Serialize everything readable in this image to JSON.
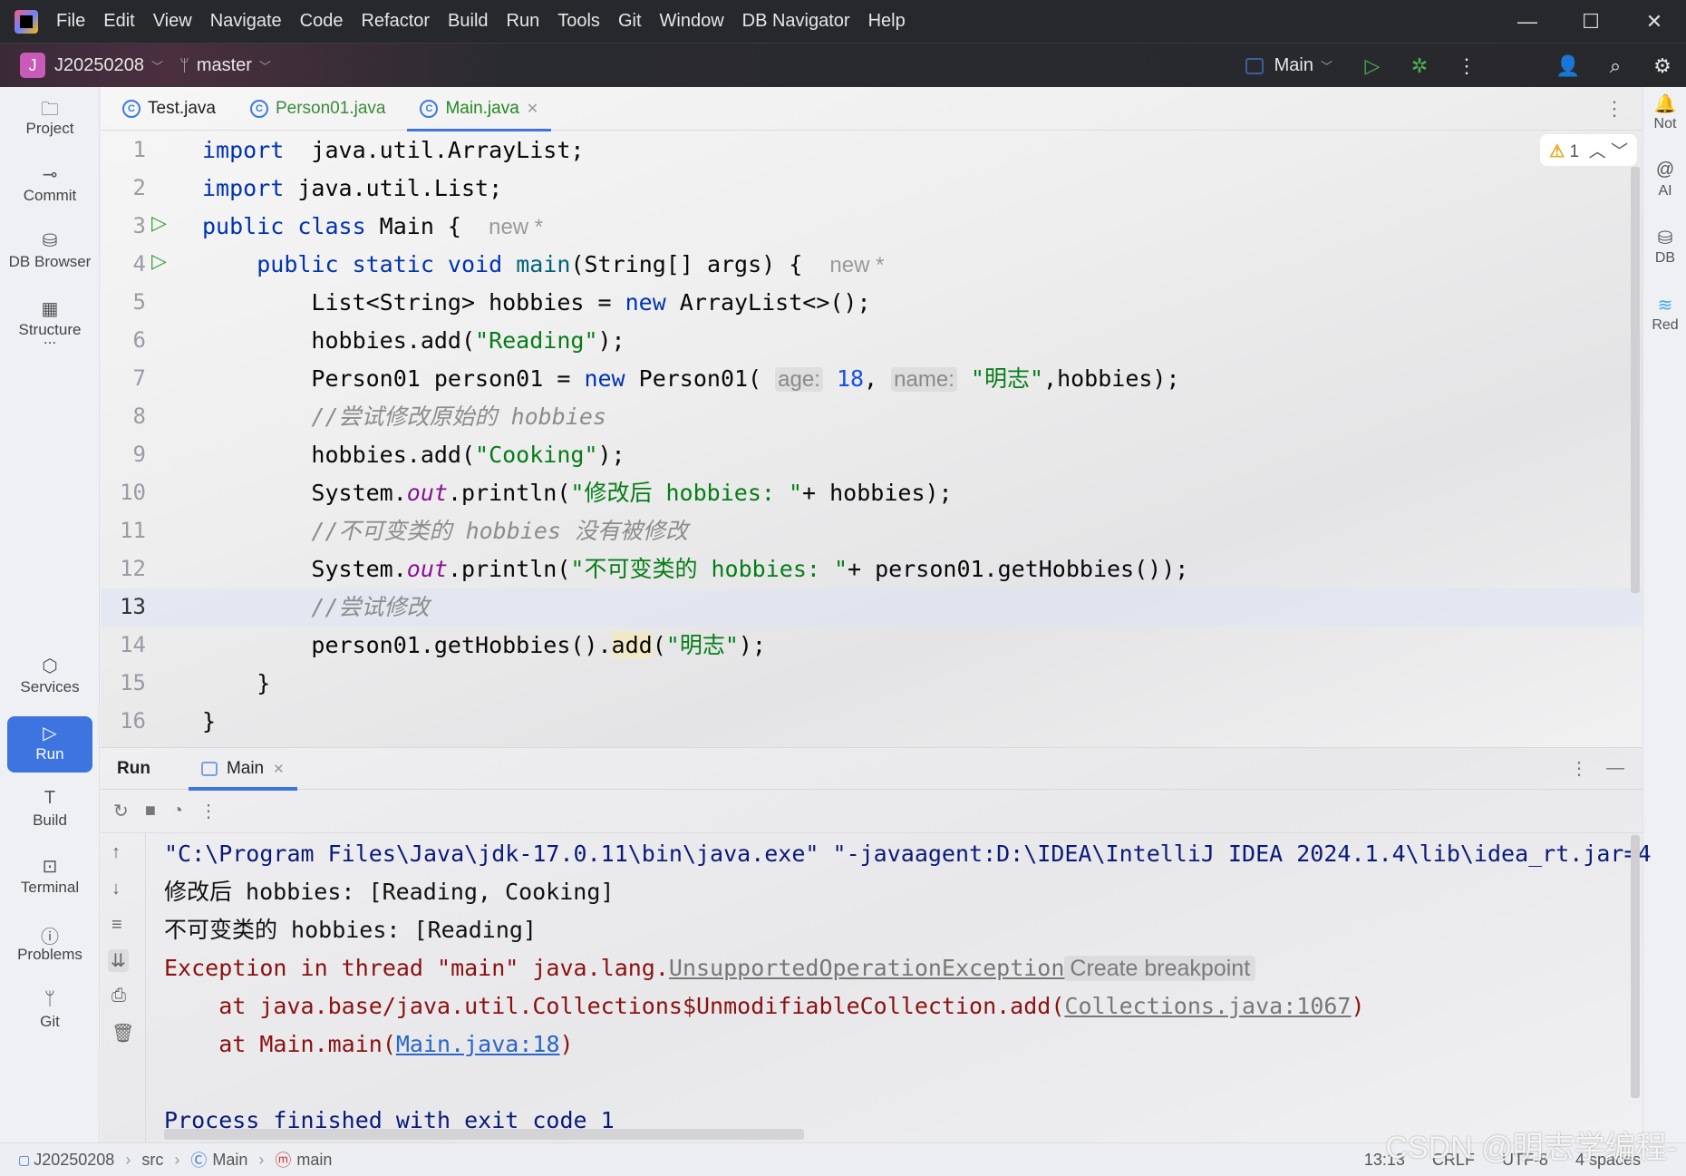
{
  "menu": [
    "File",
    "Edit",
    "View",
    "Navigate",
    "Code",
    "Refactor",
    "Build",
    "Run",
    "Tools",
    "Git",
    "Window",
    "DB Navigator",
    "Help"
  ],
  "toolbar": {
    "project_initial": "J",
    "project": "J20250208",
    "branch": "master",
    "run_config": "Main"
  },
  "left_sidebar": [
    {
      "label": "Project",
      "icon": "folder-icon"
    },
    {
      "label": "Commit",
      "icon": "commit-icon"
    },
    {
      "label": "DB Browser",
      "icon": "db-browser-icon"
    },
    {
      "label": "Structure",
      "icon": "structure-icon"
    },
    {
      "label": "...",
      "icon": "more-icon"
    },
    {
      "label": "Services",
      "icon": "services-icon"
    },
    {
      "label": "Run",
      "icon": "run-icon",
      "active": true
    },
    {
      "label": "Build",
      "icon": "hammer-icon"
    },
    {
      "label": "Terminal",
      "icon": "terminal-icon"
    },
    {
      "label": "Problems",
      "icon": "problems-icon"
    },
    {
      "label": "Git",
      "icon": "git-icon"
    }
  ],
  "right_sidebar": [
    {
      "label": "Not"
    },
    {
      "label": "AI"
    },
    {
      "label": "DB"
    },
    {
      "label": "Red"
    }
  ],
  "tabs": [
    {
      "label": "Test.java"
    },
    {
      "label": "Person01.java"
    },
    {
      "label": "Main.java",
      "active": true
    }
  ],
  "inspections": {
    "warnings": "1"
  },
  "editor": {
    "current_line": 13,
    "line_numbers": [
      "1",
      "2",
      "3",
      "4",
      "5",
      "6",
      "7",
      "8",
      "9",
      "10",
      "11",
      "12",
      "13",
      "14",
      "15",
      "16"
    ],
    "lines": [
      [
        [
          "kw",
          "import"
        ],
        [
          "",
          "  java.util.ArrayList;"
        ]
      ],
      [
        [
          "kw",
          "import"
        ],
        [
          "",
          " java.util.List;"
        ]
      ],
      [
        [
          "kw",
          "public class"
        ],
        [
          "",
          " Main {  "
        ],
        [
          "ghost",
          "new *"
        ]
      ],
      [
        [
          "",
          "    "
        ],
        [
          "kw",
          "public static void"
        ],
        [
          "",
          " "
        ],
        [
          "fn",
          "main"
        ],
        [
          "",
          "(String[] args) {  "
        ],
        [
          "ghost",
          "new *"
        ]
      ],
      [
        [
          "",
          "        List<String> hobbies = "
        ],
        [
          "kw",
          "new"
        ],
        [
          "",
          " ArrayList<>();"
        ]
      ],
      [
        [
          "",
          "        hobbies.add("
        ],
        [
          "str",
          "\"Reading\""
        ],
        [
          "",
          ");"
        ]
      ],
      [
        [
          "",
          "        Person01 person01 = "
        ],
        [
          "kw",
          "new"
        ],
        [
          "",
          " Person01( "
        ],
        [
          "hint",
          "age:"
        ],
        [
          "num",
          " 18"
        ],
        [
          "",
          ", "
        ],
        [
          "hint",
          "name:"
        ],
        [
          "str",
          " \"明志\""
        ],
        [
          "",
          ",hobbies);"
        ]
      ],
      [
        [
          "cm",
          "        //尝试修改原始的 hobbies"
        ]
      ],
      [
        [
          "",
          "        hobbies.add("
        ],
        [
          "str",
          "\"Cooking\""
        ],
        [
          "",
          ");"
        ]
      ],
      [
        [
          "",
          "        System."
        ],
        [
          "fld",
          "out"
        ],
        [
          "",
          ".println("
        ],
        [
          "str",
          "\"修改后 hobbies: \""
        ],
        [
          "",
          "+ hobbies);"
        ]
      ],
      [
        [
          "cm",
          "        //不可变类的 hobbies 没有被修改"
        ]
      ],
      [
        [
          "",
          "        System."
        ],
        [
          "fld",
          "out"
        ],
        [
          "",
          ".println("
        ],
        [
          "str",
          "\"不可变类的 hobbies: \""
        ],
        [
          "",
          "+ person01.getHobbies());"
        ]
      ],
      [
        [
          "cm",
          "        //尝试修改"
        ]
      ],
      [
        [
          "",
          "        person01.getHobbies()."
        ],
        [
          "hl",
          "add"
        ],
        [
          "",
          "("
        ],
        [
          "str",
          "\"明志\""
        ],
        [
          "",
          ");"
        ]
      ],
      [
        [
          "",
          "    }"
        ]
      ],
      [
        [
          "",
          "}"
        ]
      ]
    ]
  },
  "run_panel": {
    "title": "Run",
    "tab": "Main",
    "console": [
      [
        [
          "c-sys",
          "\"C:\\Program Files\\Java\\jdk-17.0.11\\bin\\java.exe\" \"-javaagent:D:\\IDEA\\IntelliJ IDEA 2024.1.4\\lib\\idea_rt.jar=4"
        ]
      ],
      [
        [
          "",
          "修改后 hobbies: [Reading, Cooking]"
        ]
      ],
      [
        [
          "",
          "不可变类的 hobbies: [Reading]"
        ]
      ],
      [
        [
          "c-err",
          "Exception in thread \"main\" java.lang."
        ],
        [
          "c-glink",
          "UnsupportedOperationException"
        ],
        [
          "c-bp",
          "Create breakpoint"
        ]
      ],
      [
        [
          "c-err",
          "    at java.base/java.util.Collections$UnmodifiableCollection.add("
        ],
        [
          "c-glink",
          "Collections.java:1067"
        ],
        [
          "c-err",
          ")"
        ]
      ],
      [
        [
          "c-err",
          "    at Main.main("
        ],
        [
          "c-link",
          "Main.java:18"
        ],
        [
          "c-err",
          ")"
        ]
      ],
      [
        [
          "",
          ""
        ]
      ],
      [
        [
          "c-sys",
          "Process finished with exit code 1"
        ]
      ]
    ]
  },
  "statusbar": {
    "breadcrumbs": [
      "J20250208",
      "src",
      "Main",
      "main"
    ],
    "position": "13:13",
    "line_ending": "CRLF",
    "encoding": "UTF-8",
    "indent": "4 spaces"
  },
  "watermark": "CSDN @明志学编程-"
}
